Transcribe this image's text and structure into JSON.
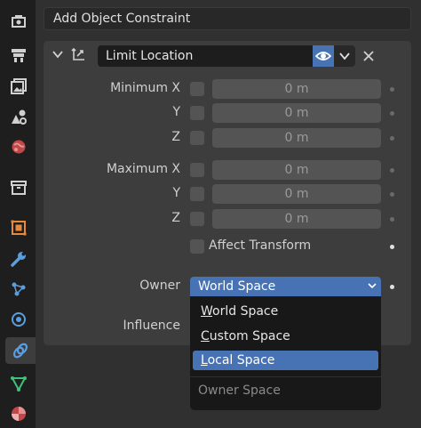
{
  "header": {
    "add_constraint_label": "Add Object Constraint"
  },
  "constraint": {
    "name": "Limit Location",
    "minimum": [
      {
        "axis_label": "Minimum X",
        "value": "0 m"
      },
      {
        "axis_label": "Y",
        "value": "0 m"
      },
      {
        "axis_label": "Z",
        "value": "0 m"
      }
    ],
    "maximum": [
      {
        "axis_label": "Maximum X",
        "value": "0 m"
      },
      {
        "axis_label": "Y",
        "value": "0 m"
      },
      {
        "axis_label": "Z",
        "value": "0 m"
      }
    ],
    "affect_transform_label": "Affect Transform",
    "owner_label": "Owner",
    "owner_value": "World Space",
    "influence_label": "Influence"
  },
  "owner_menu": {
    "items": [
      {
        "first": "W",
        "rest": "orld Space",
        "selected": false
      },
      {
        "first": "C",
        "rest": "ustom Space",
        "selected": false
      },
      {
        "first": "L",
        "rest": "ocal Space",
        "selected": true
      }
    ],
    "title": "Owner Space"
  },
  "sidebar": {
    "icons": [
      "tool-icon",
      "render-icon",
      "output-icon",
      "view-layer-icon",
      "scene-icon",
      "world-icon",
      "collection-icon",
      "object-icon",
      "modifier-icon",
      "particles-icon",
      "physics-icon",
      "constraints-icon",
      "data-icon",
      "material-icon"
    ],
    "active": "constraints-icon"
  }
}
